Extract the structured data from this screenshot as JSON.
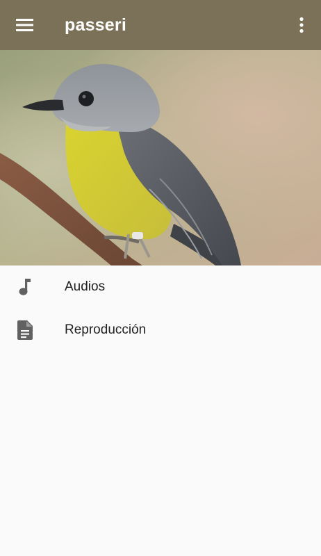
{
  "app_bar": {
    "title": "passeri",
    "background": "#7a7158",
    "menu_icon": "hamburger-menu-icon",
    "overflow_icon": "more-vert-icon"
  },
  "header_image": {
    "subject": "bird-on-branch-photo"
  },
  "nav": {
    "items": [
      {
        "label": "Audios",
        "icon": "music-note-icon"
      },
      {
        "label": "Reproducción",
        "icon": "document-icon"
      }
    ]
  }
}
